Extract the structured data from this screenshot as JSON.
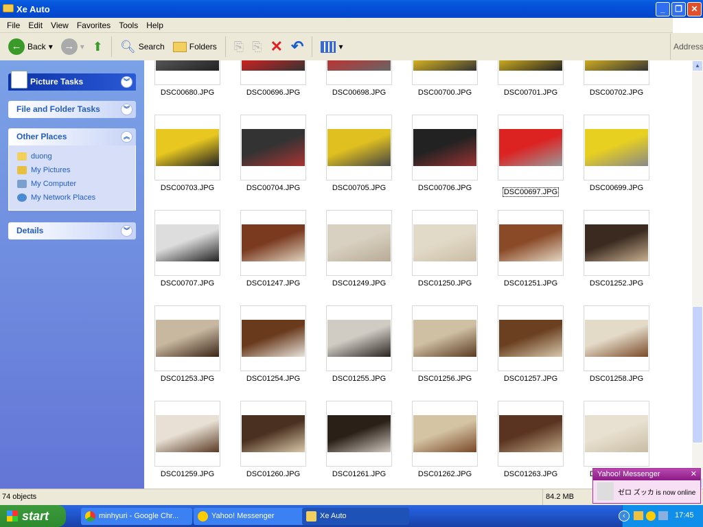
{
  "window": {
    "title": "Xe Auto"
  },
  "menu": [
    "File",
    "Edit",
    "View",
    "Favorites",
    "Tools",
    "Help"
  ],
  "toolbar": {
    "back": "Back",
    "search": "Search",
    "folders": "Folders",
    "address": "Address"
  },
  "left_pane": {
    "picture_tasks": "Picture Tasks",
    "file_folder_tasks": "File and Folder Tasks",
    "other_places": {
      "title": "Other Places",
      "items": [
        "duong",
        "My Pictures",
        "My Computer",
        "My Network Places"
      ]
    },
    "details": "Details"
  },
  "files": [
    {
      "name": "DSC00680.JPG",
      "c": [
        "#555",
        "#222"
      ]
    },
    {
      "name": "DSC00696.JPG",
      "c": [
        "#c22",
        "#333"
      ]
    },
    {
      "name": "DSC00698.JPG",
      "c": [
        "#b33",
        "#666"
      ]
    },
    {
      "name": "DSC00700.JPG",
      "c": [
        "#d4b020",
        "#333"
      ]
    },
    {
      "name": "DSC00701.JPG",
      "c": [
        "#c9a820",
        "#222"
      ]
    },
    {
      "name": "DSC00702.JPG",
      "c": [
        "#ccaa22",
        "#333"
      ]
    },
    {
      "name": "DSC00703.JPG",
      "c": [
        "#e8c820",
        "#222"
      ]
    },
    {
      "name": "DSC00704.JPG",
      "c": [
        "#333",
        "#a33"
      ]
    },
    {
      "name": "DSC00705.JPG",
      "c": [
        "#e0c020",
        "#444"
      ]
    },
    {
      "name": "DSC00706.JPG",
      "c": [
        "#222",
        "#933"
      ]
    },
    {
      "name": "DSC00697.JPG",
      "c": [
        "#dd2222",
        "#9a9a9a"
      ],
      "selected": true
    },
    {
      "name": "DSC00699.JPG",
      "c": [
        "#e8d020",
        "#888"
      ]
    },
    {
      "name": "DSC00707.JPG",
      "c": [
        "#ddd",
        "#222"
      ]
    },
    {
      "name": "DSC01247.JPG",
      "c": [
        "#7a3a20",
        "#e0d4c0"
      ]
    },
    {
      "name": "DSC01249.JPG",
      "c": [
        "#d8d0c0",
        "#b8ab96"
      ]
    },
    {
      "name": "DSC01250.JPG",
      "c": [
        "#e2dac8",
        "#c9bca4"
      ]
    },
    {
      "name": "DSC01251.JPG",
      "c": [
        "#8a4a28",
        "#e4d8c4"
      ]
    },
    {
      "name": "DSC01252.JPG",
      "c": [
        "#3a2a20",
        "#c8b090"
      ]
    },
    {
      "name": "DSC01253.JPG",
      "c": [
        "#c8b8a0",
        "#3a2416"
      ]
    },
    {
      "name": "DSC01254.JPG",
      "c": [
        "#6a3a1c",
        "#e8e4dc"
      ]
    },
    {
      "name": "DSC01255.JPG",
      "c": [
        "#d0ccc4",
        "#2a2420"
      ]
    },
    {
      "name": "DSC01256.JPG",
      "c": [
        "#cfc0a4",
        "#5a3a20"
      ]
    },
    {
      "name": "DSC01257.JPG",
      "c": [
        "#6a4020",
        "#d8c8ac"
      ]
    },
    {
      "name": "DSC01258.JPG",
      "c": [
        "#e4dac8",
        "#7a4a28"
      ]
    },
    {
      "name": "DSC01259.JPG",
      "c": [
        "#e8e0d4",
        "#5a3a24"
      ]
    },
    {
      "name": "DSC01260.JPG",
      "c": [
        "#4a3020",
        "#d8c8a8"
      ]
    },
    {
      "name": "DSC01261.JPG",
      "c": [
        "#2a2018",
        "#d0c8c0"
      ]
    },
    {
      "name": "DSC01262.JPG",
      "c": [
        "#d4c4a4",
        "#7a4828"
      ]
    },
    {
      "name": "DSC01263.JPG",
      "c": [
        "#5a3420",
        "#c0a888"
      ]
    },
    {
      "name": "DSC01264.JPG",
      "c": [
        "#e8e0d0",
        "#c8bca4"
      ]
    }
  ],
  "status": {
    "objects": "74 objects",
    "size": "84.2 MB"
  },
  "taskbar": {
    "start": "start",
    "buttons": [
      "minhyuri - Google Chr...",
      "Yahoo! Messenger",
      "Xe Auto"
    ],
    "clock": "17:45"
  },
  "notification": {
    "title": "Yahoo! Messenger",
    "message": "ゼロ ズッカ is now online"
  }
}
